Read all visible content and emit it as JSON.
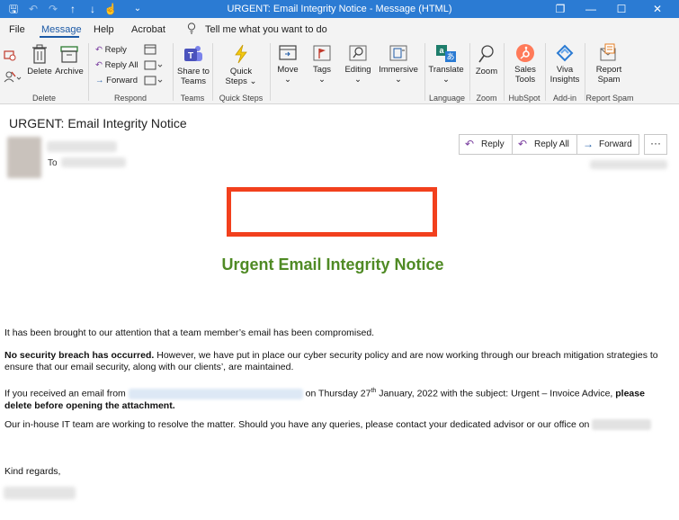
{
  "window": {
    "title": "URGENT: Email Integrity Notice  -  Message (HTML)",
    "controls": {
      "restore": "❐",
      "minimize": "—",
      "maximize": "☐",
      "close": "✕"
    }
  },
  "quick_access": {
    "save": "🖫",
    "undo": "↶",
    "redo": "↷",
    "up": "↑",
    "down": "↓",
    "touch": "☝",
    "more": "⌄"
  },
  "menu": {
    "file": "File",
    "message": "Message",
    "help": "Help",
    "acrobat": "Acrobat",
    "tell_me": "Tell me what you want to do"
  },
  "ribbon": {
    "delete": "Delete",
    "archive": "Archive",
    "reply": "Reply",
    "reply_all": "Reply All",
    "forward": "Forward",
    "share_to_teams_1": "Share to",
    "share_to_teams_2": "Teams",
    "quick_steps_1": "Quick",
    "quick_steps_2": "Steps ⌄",
    "move": "Move",
    "tags": "Tags",
    "editing": "Editing",
    "immersive": "Immersive",
    "translate": "Translate",
    "zoom": "Zoom",
    "sales_tools_1": "Sales",
    "sales_tools_2": "Tools",
    "viva_insights_1": "Viva",
    "viva_insights_2": "Insights",
    "report_spam_1": "Report",
    "report_spam_2": "Spam",
    "dropdown": "⌄",
    "groups": {
      "delete": "Delete",
      "respond": "Respond",
      "teams": "Teams",
      "quick_steps": "Quick Steps",
      "language": "Language",
      "zoom": "Zoom",
      "hubspot": "HubSpot",
      "add_in": "Add-in",
      "report_spam": "Report Spam"
    }
  },
  "message": {
    "subject": "URGENT: Email Integrity Notice",
    "to_label": "To",
    "actions": {
      "reply": "Reply",
      "reply_all": "Reply All",
      "forward": "Forward",
      "more": "···"
    }
  },
  "body": {
    "heading": "Urgent Email Integrity Notice",
    "p1": "It has been brought to our attention that a team member’s email has been compromised.",
    "p2_bold": "No security breach has occurred.",
    "p2_rest": " However, we have put in place our cyber security policy and are now working through our breach mitigation strategies to ensure that our email security, along with our clients’, are maintained.",
    "p3_start": "If you received an email from ",
    "p3_mid": " on Thursday 27",
    "p3_sup": "th",
    "p3_mid2": " January, 2022 with the subject: Urgent – Invoice Advice, ",
    "p3_bold": "please delete before opening the attachment.",
    "p4": "Our in-house IT team are working to resolve the matter. Should you have any queries, please contact your dedicated advisor or our office on ",
    "closing": "Kind regards,"
  },
  "colors": {
    "titlebar": "#2b7bd3",
    "heading_green": "#4f8a24",
    "logo_border": "#f2401d",
    "accent_blue": "#1d5aa6"
  },
  "icons": [
    "save-icon",
    "undo-icon",
    "redo-icon",
    "up-arrow-icon",
    "down-arrow-icon",
    "touch-icon",
    "customize-icon",
    "lightbulb-icon",
    "trash-icon",
    "archive-icon",
    "reply-icon",
    "reply-all-icon",
    "forward-icon",
    "teams-icon",
    "lightning-icon",
    "move-icon",
    "flag-icon",
    "search-icon",
    "immersive-reader-icon",
    "translate-icon",
    "zoom-icon",
    "hubspot-icon",
    "viva-icon",
    "report-icon"
  ]
}
